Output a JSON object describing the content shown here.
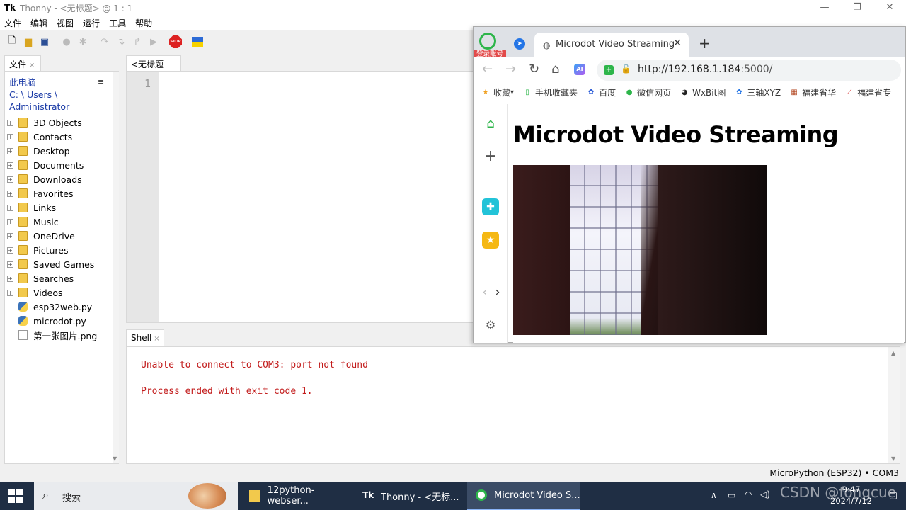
{
  "thonny": {
    "title": "Thonny  -  <无标题>  @  1 : 1",
    "menu": [
      "文件",
      "编辑",
      "视图",
      "运行",
      "工具",
      "帮助"
    ],
    "window_controls": [
      "—",
      "❐",
      "✕"
    ],
    "files_tab": "文件",
    "files_location": [
      "此电脑",
      "C: \\ Users \\",
      "Administrator"
    ],
    "files": [
      {
        "name": "3D Objects",
        "kind": "folder"
      },
      {
        "name": "Contacts",
        "kind": "folder"
      },
      {
        "name": "Desktop",
        "kind": "folder"
      },
      {
        "name": "Documents",
        "kind": "folder"
      },
      {
        "name": "Downloads",
        "kind": "folder"
      },
      {
        "name": "Favorites",
        "kind": "folder"
      },
      {
        "name": "Links",
        "kind": "folder"
      },
      {
        "name": "Music",
        "kind": "folder"
      },
      {
        "name": "OneDrive",
        "kind": "folder"
      },
      {
        "name": "Pictures",
        "kind": "folder"
      },
      {
        "name": "Saved Games",
        "kind": "folder"
      },
      {
        "name": "Searches",
        "kind": "folder"
      },
      {
        "name": "Videos",
        "kind": "folder"
      },
      {
        "name": "esp32web.py",
        "kind": "python"
      },
      {
        "name": "microdot.py",
        "kind": "python"
      },
      {
        "name": "第一张图片.png",
        "kind": "image"
      }
    ],
    "editor_tab": "<无标题>",
    "line_number": "1",
    "shell_tab": "Shell",
    "shell_lines": [
      "Unable to connect to COM3: port not found",
      "Process ended with exit code 1."
    ],
    "status": "MicroPython (ESP32)  •  COM3",
    "close_glyph": "×"
  },
  "browser": {
    "login_badge": "登录账号",
    "tab_title": "Microdot Video Streaming",
    "tab_close": "✕",
    "new_tab": "+",
    "url_host": "http://192.168.1.184",
    "url_port": ":5000/",
    "ai_label": "AI",
    "bookmarks": [
      {
        "label": "收藏",
        "icon": "star-icon",
        "color": "#f0a020"
      },
      {
        "label": "手机收藏夹",
        "icon": "phone-icon",
        "color": "#2db54a"
      },
      {
        "label": "百度",
        "icon": "baidu-paw-icon",
        "color": "#2a5bd7"
      },
      {
        "label": "微信网页",
        "icon": "wechat-icon",
        "color": "#2db54a"
      },
      {
        "label": "WxBit图",
        "icon": "panda-icon",
        "color": "#222222"
      },
      {
        "label": "三轴XYZ",
        "icon": "gear-icon",
        "color": "#2475e6"
      },
      {
        "label": "福建省华",
        "icon": "building-icon",
        "color": "#b0401a"
      },
      {
        "label": "福建省专",
        "icon": "swoosh-icon",
        "color": "#d22222"
      }
    ],
    "page_heading": "Microdot Video Streaming"
  },
  "taskbar": {
    "search_placeholder": "搜索",
    "tasks": [
      {
        "label": "12python-webser...",
        "icon": "folder-icon"
      },
      {
        "label": "Thonny  -  <无标...",
        "icon": "thonny-icon"
      },
      {
        "label": "Microdot Video S...",
        "icon": "browser-icon"
      }
    ],
    "time": "9:47",
    "date": "2024/7/12",
    "watermark": "CSDN @fongcue"
  }
}
